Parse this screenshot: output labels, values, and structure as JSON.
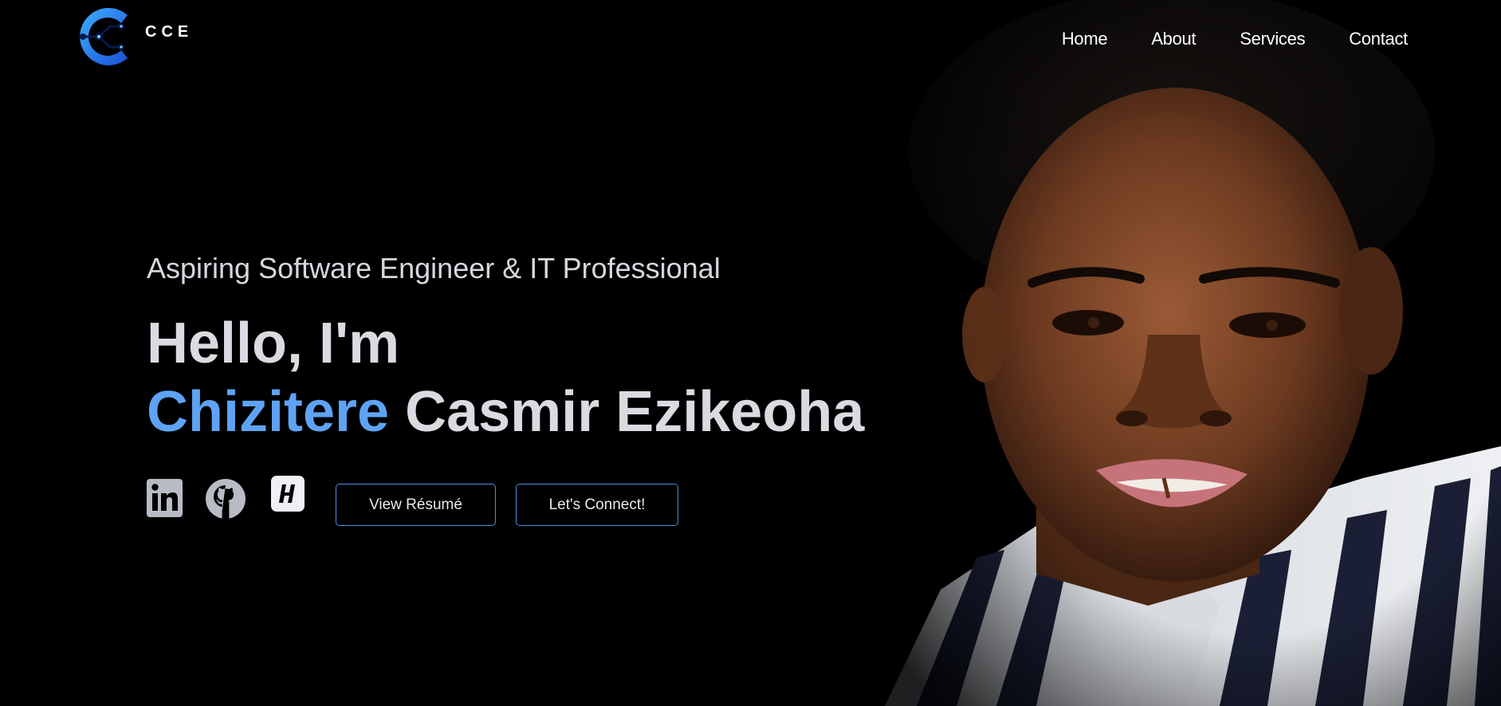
{
  "header": {
    "logo_text": "CCE",
    "logo_icon": "circuit-c-logo-icon",
    "nav": [
      {
        "label": "Home"
      },
      {
        "label": "About"
      },
      {
        "label": "Services"
      },
      {
        "label": "Contact"
      }
    ]
  },
  "hero": {
    "tagline": "Aspiring Software Engineer & IT Professional",
    "greeting": "Hello, I'm",
    "name_first": "Chizitere",
    "name_rest": " Casmir Ezikeoha",
    "socials": [
      {
        "name": "linkedin-icon"
      },
      {
        "name": "github-icon"
      },
      {
        "name": "hashnode-icon"
      }
    ],
    "buttons": {
      "resume": "View Résumé",
      "connect": "Let's Connect!"
    }
  },
  "colors": {
    "background": "#000000",
    "accent": "#5ea3f3",
    "button_border": "#4f8fe0",
    "heading": "#d9dbe0",
    "social_icon": "#b8bcc4"
  }
}
